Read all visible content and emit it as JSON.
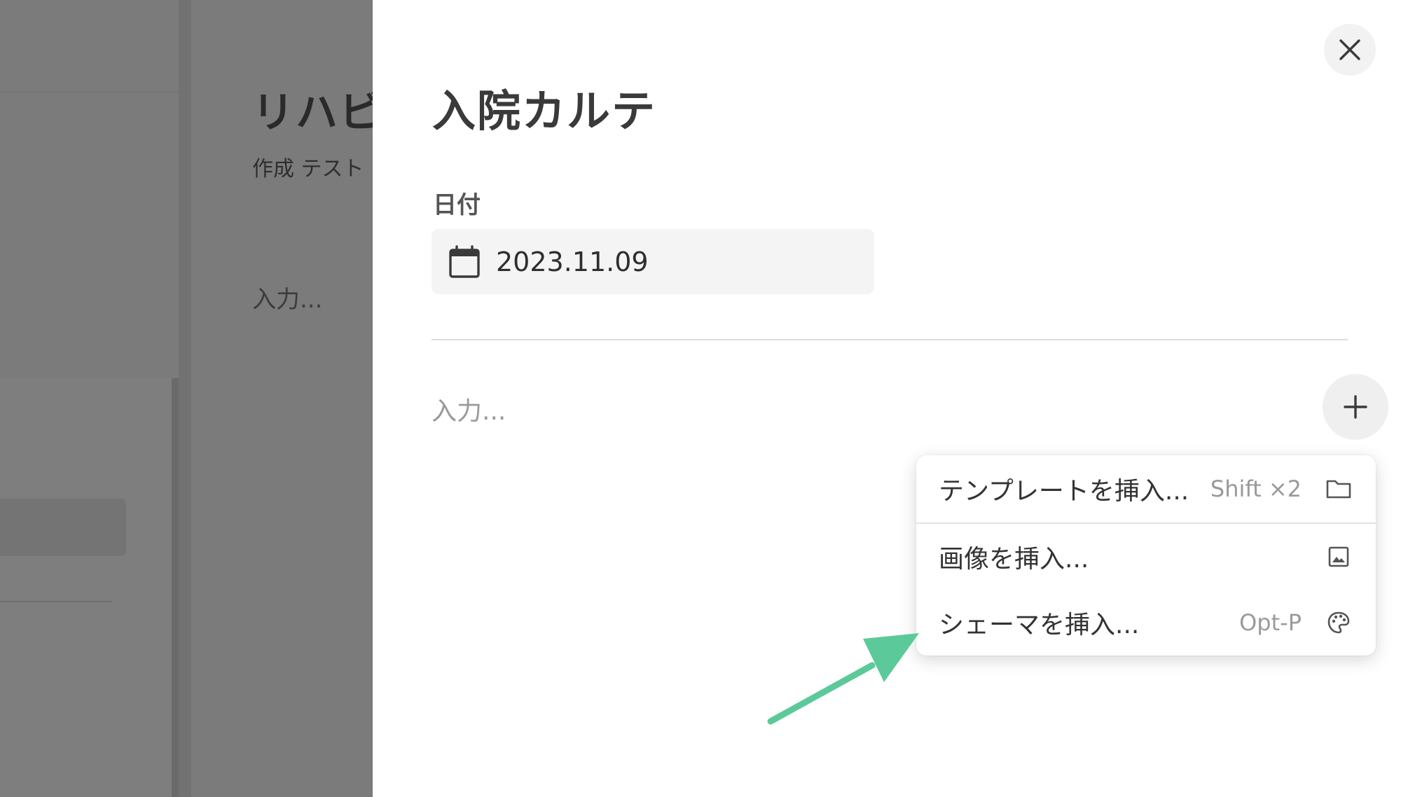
{
  "background": {
    "title": "リハビ",
    "subtitle": "作成 テスト　",
    "input_placeholder": "入力..."
  },
  "sheet": {
    "title": "入院カルテ",
    "date_label": "日付",
    "date_value": "2023.11.09",
    "body_placeholder": "入力..."
  },
  "menu": {
    "items": [
      {
        "label": "テンプレートを挿入...",
        "shortcut": "Shift ×2",
        "icon": "folder-icon"
      },
      {
        "label": "画像を挿入...",
        "shortcut": "",
        "icon": "image-icon"
      },
      {
        "label": "シェーマを挿入...",
        "shortcut": "Opt-P",
        "icon": "palette-icon"
      }
    ]
  },
  "icons": {
    "close": "close-icon",
    "add": "plus-icon",
    "date": "calendar-icon"
  },
  "colors": {
    "overlay": "#7b7b7b",
    "arrow": "#5cc99b"
  }
}
